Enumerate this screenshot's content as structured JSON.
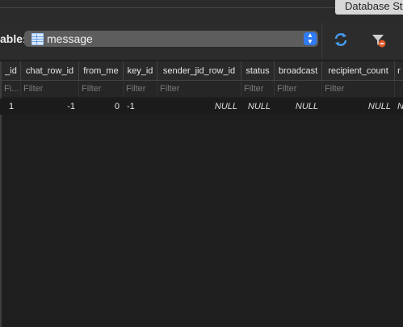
{
  "window": {
    "tab_label": "Database St"
  },
  "toolbar": {
    "table_label": "able:",
    "table_value": "message",
    "stepper_glyph": "▲▼"
  },
  "grid": {
    "columns": [
      "_id",
      "chat_row_id",
      "from_me",
      "key_id",
      "sender_jid_row_id",
      "status",
      "broadcast",
      "recipient_count",
      "r"
    ],
    "filters": [
      "Fi...",
      "Filter",
      "Filter",
      "Filter",
      "Filter",
      "Filter",
      "Filter",
      "Filter",
      ""
    ],
    "rows": [
      [
        "1",
        "-1",
        "0",
        "-1",
        "NULL",
        "NULL",
        "NULL",
        "NULL",
        "N"
      ]
    ]
  },
  "icons": {
    "refresh": "refresh-icon",
    "filter": "filter-icon",
    "table": "table-icon"
  },
  "colors": {
    "accent": "#2f7cf6",
    "background": "#1e1e1e"
  }
}
